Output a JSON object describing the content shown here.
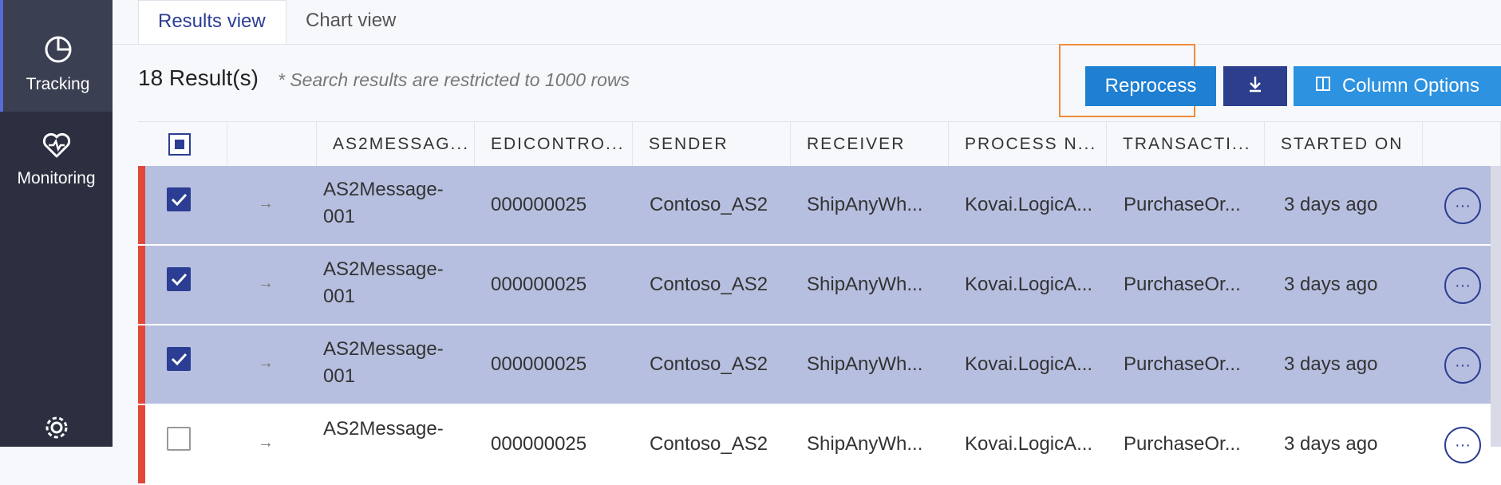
{
  "sidebar": {
    "items": [
      {
        "label": "Tracking",
        "icon": "pie-chart-icon",
        "active": true
      },
      {
        "label": "Monitoring",
        "icon": "heart-pulse-icon",
        "active": false
      }
    ],
    "settings_icon": "gear-icon"
  },
  "tabs": [
    {
      "label": "Results view",
      "active": true
    },
    {
      "label": "Chart view",
      "active": false
    }
  ],
  "results": {
    "count_label": "18 Result(s)",
    "note": "* Search results are restricted to 1000 rows"
  },
  "toolbar": {
    "reprocess_label": "Reprocess",
    "download_icon": "download-icon",
    "column_options_label": "Column Options",
    "column_options_icon": "columns-icon"
  },
  "table": {
    "columns": [
      "AS2MESSAG...",
      "EDICONTRO...",
      "SENDER",
      "RECEIVER",
      "PROCESS N...",
      "TRANSACTI...",
      "STARTED ON"
    ],
    "rows": [
      {
        "selected": true,
        "as2_line1": "AS2Message-",
        "as2_line2": "001",
        "edicontrol": "000000025",
        "sender": "Contoso_AS2",
        "receiver": "ShipAnyWh...",
        "process": "Kovai.LogicA...",
        "transaction": "PurchaseOr...",
        "started": "3 days ago"
      },
      {
        "selected": true,
        "as2_line1": "AS2Message-",
        "as2_line2": "001",
        "edicontrol": "000000025",
        "sender": "Contoso_AS2",
        "receiver": "ShipAnyWh...",
        "process": "Kovai.LogicA...",
        "transaction": "PurchaseOr...",
        "started": "3 days ago"
      },
      {
        "selected": true,
        "as2_line1": "AS2Message-",
        "as2_line2": "001",
        "edicontrol": "000000025",
        "sender": "Contoso_AS2",
        "receiver": "ShipAnyWh...",
        "process": "Kovai.LogicA...",
        "transaction": "PurchaseOr...",
        "started": "3 days ago"
      },
      {
        "selected": false,
        "as2_line1": "AS2Message-",
        "as2_line2": "",
        "edicontrol": "000000025",
        "sender": "Contoso_AS2",
        "receiver": "ShipAnyWh...",
        "process": "Kovai.LogicA...",
        "transaction": "PurchaseOr...",
        "started": "3 days ago"
      }
    ]
  },
  "colors": {
    "sidebar_bg": "#2b2f3f",
    "accent": "#2c3e93",
    "reprocess_bg": "#1f7fd1",
    "selected_row": "#b7bfe0",
    "status_bar": "#e2483a",
    "highlight": "#f08c3a"
  }
}
